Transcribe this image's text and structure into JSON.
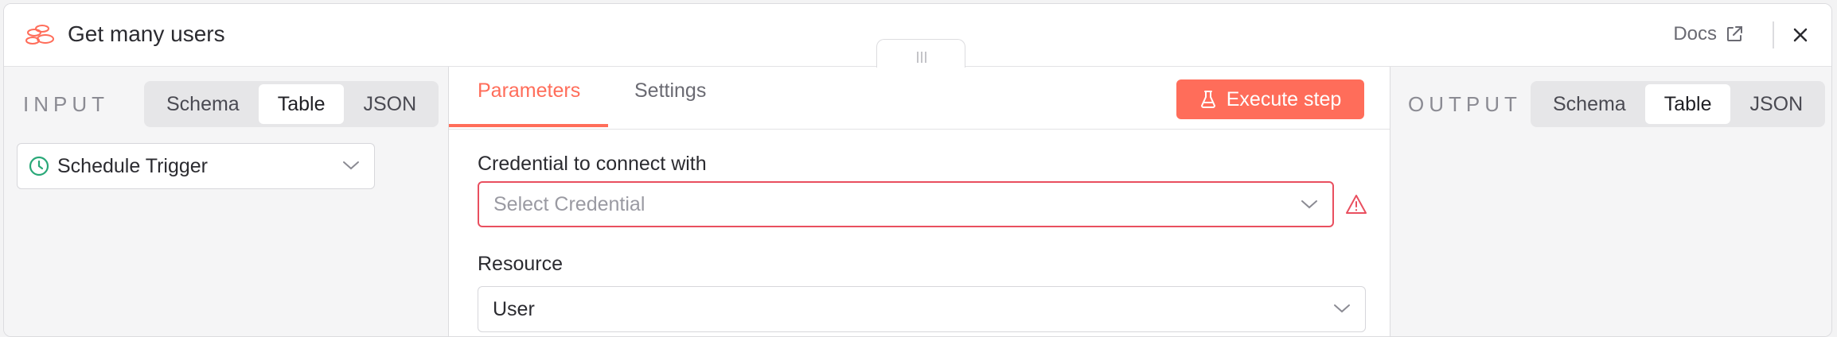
{
  "header": {
    "title": "Get many users",
    "docs_label": "Docs",
    "close_icon": "close-icon",
    "node_icon": "clouds-icon",
    "accent": "#ff6d5a"
  },
  "input_panel": {
    "label": "INPUT",
    "view_options": [
      "Schema",
      "Table",
      "JSON"
    ],
    "active_view": "Table",
    "trigger_select": {
      "value": "Schedule Trigger",
      "icon": "clock-icon"
    }
  },
  "main_panel": {
    "tabs": [
      {
        "label": "Parameters",
        "active": true
      },
      {
        "label": "Settings",
        "active": false
      }
    ],
    "execute_button": {
      "label": "Execute step",
      "icon": "flask-icon"
    },
    "fields": {
      "credential": {
        "label": "Credential to connect with",
        "placeholder": "Select Credential",
        "status": "error"
      },
      "resource": {
        "label": "Resource",
        "value": "User"
      }
    }
  },
  "output_panel": {
    "label": "OUTPUT",
    "view_options": [
      "Schema",
      "Table",
      "JSON"
    ],
    "active_view": "Table"
  },
  "colors": {
    "accent": "#ff6d5a",
    "error": "#e94f5f",
    "success": "#29a878"
  }
}
